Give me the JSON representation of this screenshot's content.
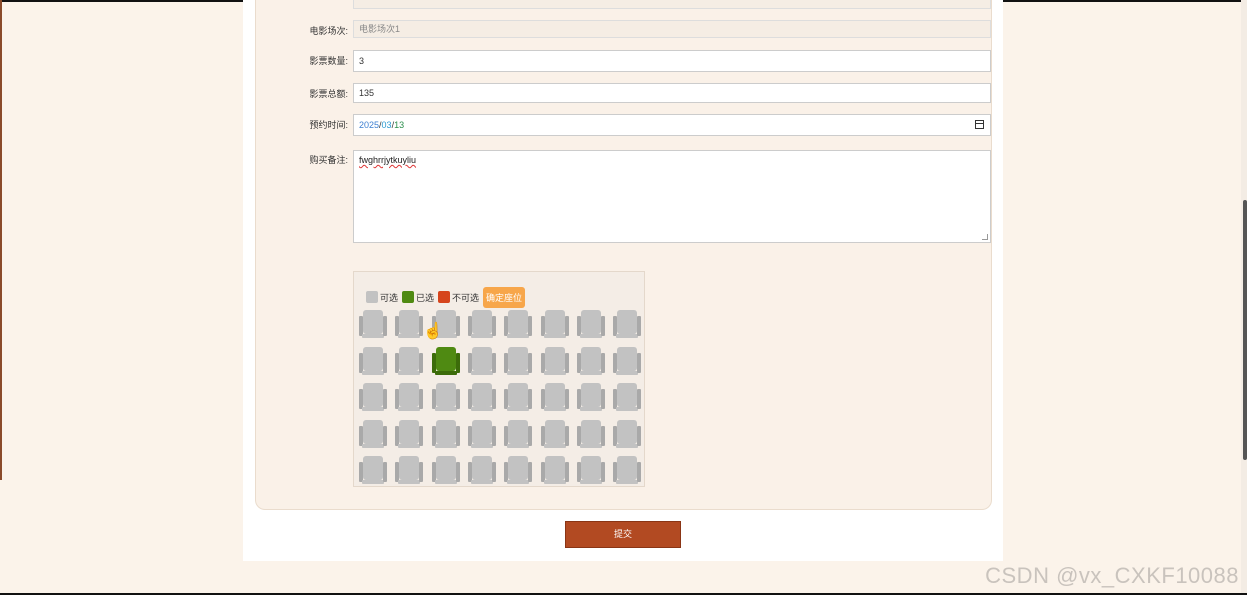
{
  "form": {
    "session": {
      "label": "电影场次:",
      "value": "电影场次1"
    },
    "quantity": {
      "label": "影票数量:",
      "value": "3"
    },
    "total": {
      "label": "影票总额:",
      "value": "135"
    },
    "date": {
      "label": "预约时间:",
      "year": "2025",
      "month": "03",
      "day": "13",
      "sep": "/"
    },
    "note": {
      "label": "购买备注:",
      "value": "fwghrrjytkuyliu"
    }
  },
  "seats": {
    "legend": {
      "available": "可选",
      "selected": "已选",
      "unavailable": "不可选"
    },
    "choose_button": "确定座位",
    "rows": [
      [
        "avail",
        "avail",
        "avail",
        "avail",
        "avail",
        "avail",
        "avail",
        "avail"
      ],
      [
        "avail",
        "avail",
        "selected",
        "avail",
        "avail",
        "avail",
        "avail",
        "avail"
      ],
      [
        "avail",
        "avail",
        "avail",
        "avail",
        "avail",
        "avail",
        "avail",
        "avail"
      ],
      [
        "avail",
        "avail",
        "avail",
        "avail",
        "avail",
        "avail",
        "avail",
        "avail"
      ],
      [
        "avail",
        "avail",
        "avail",
        "avail",
        "avail",
        "avail",
        "avail",
        "avail"
      ]
    ],
    "colors": {
      "available": "#c2c2c2",
      "selected": "#4f8a12",
      "unavailable": "#d6451c"
    }
  },
  "submit_label": "提交",
  "watermark": "CSDN @vx_CXKF10088"
}
